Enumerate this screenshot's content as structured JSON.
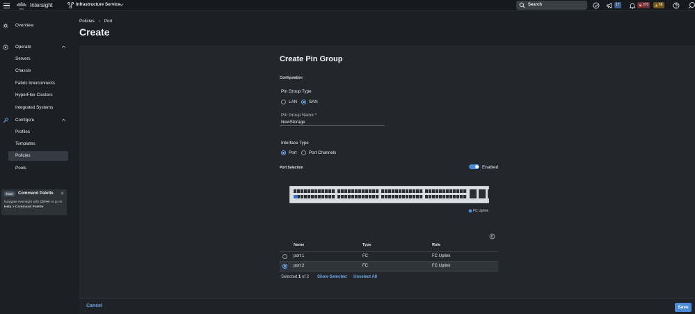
{
  "topbar": {
    "brand": "Intersight",
    "service": "Infrastructure Service",
    "search_label": "Search",
    "badge_notifications": "17",
    "badge_critical": "370",
    "badge_warning": "66"
  },
  "sidebar": {
    "overview": "Overview",
    "operate": "Operate",
    "operate_items": [
      "Servers",
      "Chassis",
      "Fabric Interconnects",
      "HyperFlex Clusters",
      "Integrated Systems"
    ],
    "configure": "Configure",
    "configure_items": [
      "Profiles",
      "Templates",
      "Policies",
      "Pools"
    ],
    "selected": "Policies"
  },
  "palette": {
    "new_label": "New",
    "title": "Command Palette",
    "desc_prefix": "Navigate Intersight with ",
    "shortcut": "Ctrl+K",
    "desc_mid": " or go to ",
    "path": "Help > Command Palette"
  },
  "header": {
    "crumb1": "Policies",
    "crumb_sep": "›",
    "crumb2": "Port",
    "title": "Create"
  },
  "form": {
    "title": "Create Pin Group",
    "section_config": "Configuration",
    "pin_group_type_label": "Pin Group Type",
    "pin_group_type_options": [
      "LAN",
      "SAN"
    ],
    "pin_group_type_selected": "SAN",
    "pin_group_name_label": "Pin Group Name *",
    "pin_group_name_value": "NewStorage",
    "interface_type_label": "Interface Type",
    "interface_type_options": [
      "Port",
      "Port Channels"
    ],
    "interface_type_selected": "Port",
    "port_selection_label": "Port Selection",
    "toggle_label": "Enabled",
    "legend_fc_uplink": "FC Uplink"
  },
  "table": {
    "columns": [
      "Name",
      "Type",
      "Role"
    ],
    "rows": [
      {
        "name": "port 1",
        "type": "FC",
        "role": "FC Uplink",
        "selected": false
      },
      {
        "name": "port 2",
        "type": "FC",
        "role": "FC Uplink",
        "selected": true
      }
    ],
    "selected_prefix": "Selected ",
    "selected_count": "1",
    "selected_of": " of ",
    "selected_total": "2",
    "show_selected": "Show Selected",
    "unselect_all": "Unselect All"
  },
  "footer": {
    "cancel": "Cancel",
    "save": "Save"
  },
  "colors": {
    "accent": "#4a8ad6",
    "link": "#6ea6e8",
    "critical": "#e05a5a",
    "warning": "#e0a030"
  }
}
